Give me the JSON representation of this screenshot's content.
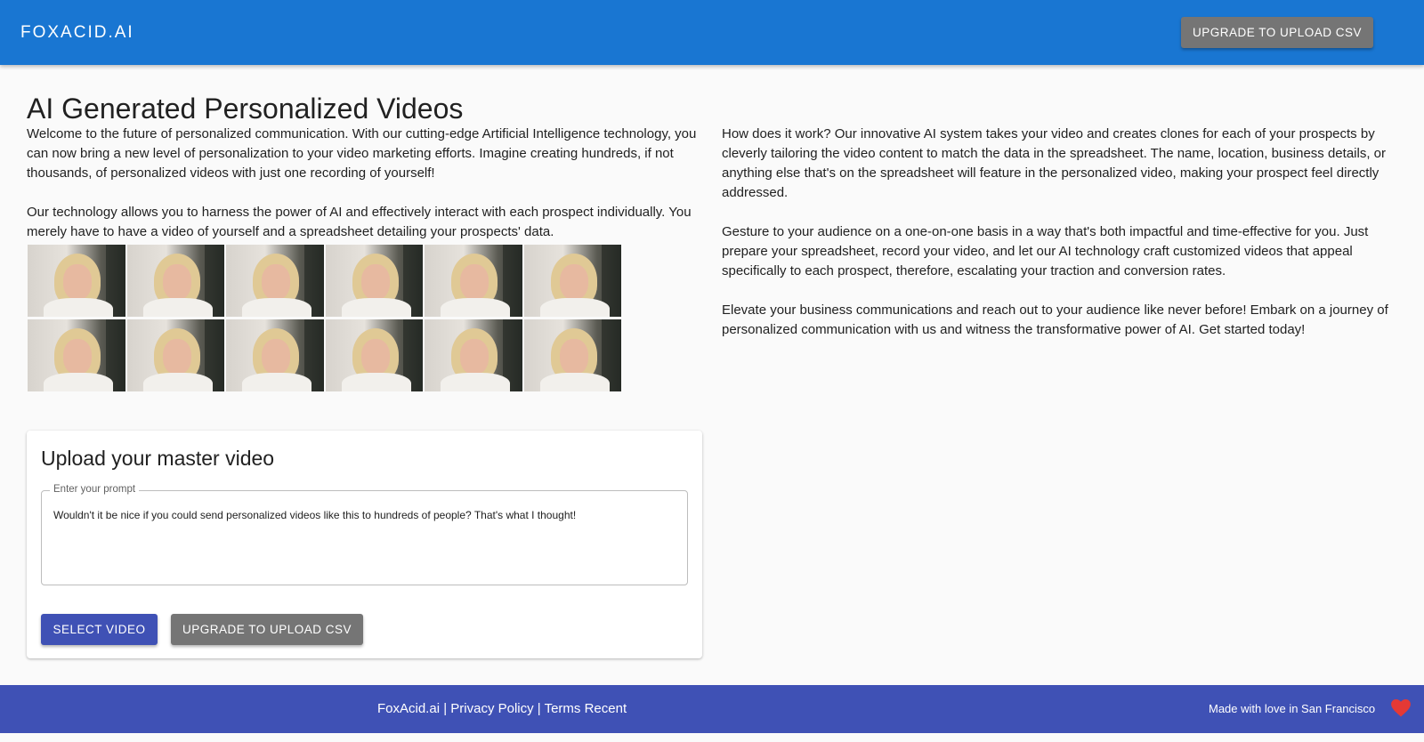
{
  "header": {
    "brand": "FOXACID.AI",
    "upgrade_label": "UPGRADE TO UPLOAD CSV"
  },
  "main": {
    "title": "AI Generated Personalized Videos",
    "left_paragraphs": [
      "Welcome to the future of personalized communication. With our cutting-edge Artificial Intelligence technology, you can now bring a new level of personalization to your video marketing efforts. Imagine creating hundreds, if not thousands, of personalized videos with just one recording of yourself!",
      "Our technology allows you to harness the power of AI and effectively interact with each prospect individually. You merely have to have a video of yourself and a spreadsheet detailing your prospects' data."
    ],
    "right_paragraphs": [
      "How does it work? Our innovative AI system takes your video and creates clones for each of your prospects by cleverly tailoring the video content to match the data in the spreadsheet. The name, location, business details, or anything else that's on the spreadsheet will feature in the personalized video, making your prospect feel directly addressed.",
      "Gesture to your audience on a one-on-one basis in a way that's both impactful and time-effective for you. Just prepare your spreadsheet, record your video, and let our AI technology craft customized videos that appeal specifically to each prospect, therefore, escalating your traction and conversion rates.",
      "Elevate your business communications and reach out to your audience like never before! Embark on a journey of personalized communication with us and witness the transformative power of AI. Get started today!"
    ]
  },
  "upload_card": {
    "title": "Upload your master video",
    "prompt_label": "Enter your prompt",
    "prompt_value": "Wouldn't it be nice if you could send personalized videos like this to hundreds of people? That's what I thought!",
    "select_label": "SELECT VIDEO",
    "upgrade_label": "UPGRADE TO UPLOAD CSV"
  },
  "footer": {
    "link_home": "FoxAcid.ai",
    "sep1": " | ",
    "link_privacy": "Privacy Policy",
    "sep2": " | ",
    "link_terms": "Terms Recent",
    "credit": "Made with love in San Francisco",
    "heart_icon": "heart-icon"
  },
  "colors": {
    "header_bg": "#1976d2",
    "footer_bg": "#3f51b5",
    "primary_button": "#3f51b5",
    "gray_button": "#757575",
    "heart": "#e53935"
  }
}
